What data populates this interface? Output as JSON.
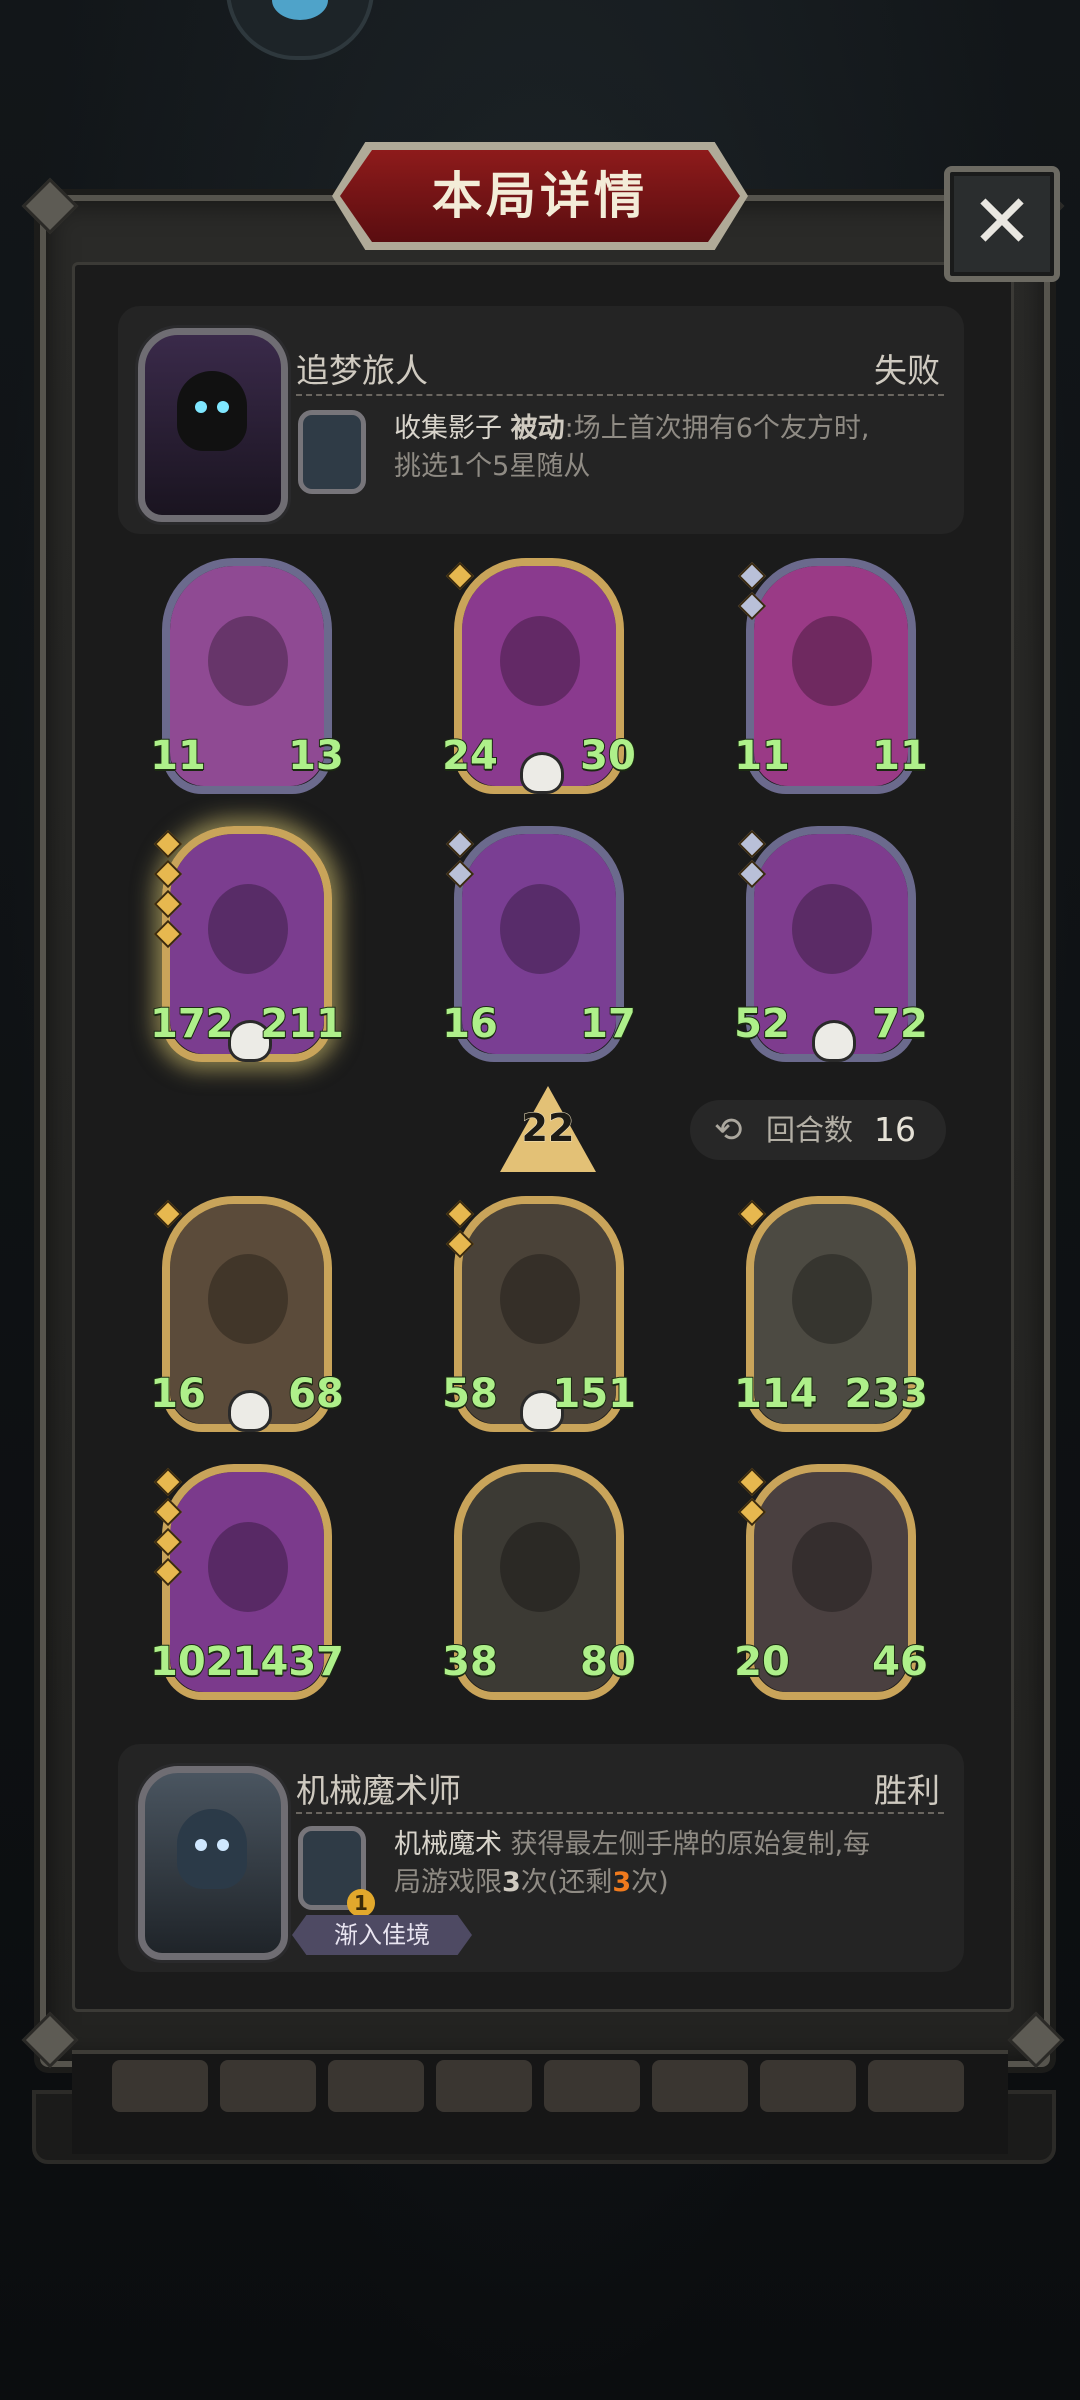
{
  "title": "本局详情",
  "close_label": "✕",
  "opponent": {
    "name": "追梦旅人",
    "result": "失败",
    "skill_name": "收集影子",
    "skill_type": "被动",
    "skill_desc_1": ":场上首次拥有6个友方时,",
    "skill_desc_2": "挑选1个5星随从"
  },
  "opponent_board": [
    {
      "atk": "11",
      "hp": "13",
      "stars": 0,
      "tier": "silver",
      "skull": false,
      "art": "#8f4a93"
    },
    {
      "atk": "24",
      "hp": "30",
      "stars": 1,
      "tier": "gold",
      "skull": true,
      "art": "#8a3a8e"
    },
    {
      "atk": "11",
      "hp": "11",
      "stars": 2,
      "tier": "silver",
      "skull": false,
      "art": "#9a3a86"
    },
    {
      "atk": "172",
      "hp": "211",
      "stars": 4,
      "tier": "gold",
      "skull": true,
      "art": "#7b3d8f",
      "glow": true
    },
    {
      "atk": "16",
      "hp": "17",
      "stars": 2,
      "tier": "silver",
      "skull": false,
      "art": "#7a3e93"
    },
    {
      "atk": "52",
      "hp": "72",
      "stars": 2,
      "tier": "silver",
      "skull": true,
      "art": "#7e3c8e"
    }
  ],
  "level": "22",
  "rounds_icon": "⟲",
  "rounds_label": "回合数",
  "rounds_value": "16",
  "player_board": [
    {
      "atk": "16",
      "hp": "68",
      "stars": 1,
      "tier": "gold",
      "skull": true,
      "art": "#5b4b3a"
    },
    {
      "atk": "58",
      "hp": "151",
      "stars": 2,
      "tier": "gold",
      "skull": true,
      "art": "#4a4238"
    },
    {
      "atk": "114",
      "hp": "233",
      "stars": 1,
      "tier": "gold",
      "skull": false,
      "art": "#4c4a42"
    },
    {
      "atk": "1021",
      "hp": "1437",
      "stars": 4,
      "tier": "gold",
      "skull": false,
      "art": "#7b3a8c"
    },
    {
      "atk": "38",
      "hp": "80",
      "stars": 0,
      "tier": "gold",
      "skull": false,
      "art": "#3c3a34"
    },
    {
      "atk": "20",
      "hp": "46",
      "stars": 2,
      "tier": "gold",
      "skull": false,
      "art": "#4a4040"
    }
  ],
  "player": {
    "name": "机械魔术师",
    "result": "胜利",
    "skill_name": "机械魔术",
    "skill_desc_1": "获得最左侧手牌的原始复制,每",
    "skill_desc_2a": "局游戏限",
    "skill_limit": "3",
    "skill_desc_2b": "次(还剩",
    "skill_remaining": "3",
    "skill_desc_2c": "次)",
    "badge": "渐入佳境",
    "skill_level_icon": "1"
  },
  "colors": {
    "accent": "#8e1b1b",
    "stat_text": "#aef08a",
    "gold_frame": "#c9a45a",
    "silver_frame": "#6b6a8d"
  }
}
